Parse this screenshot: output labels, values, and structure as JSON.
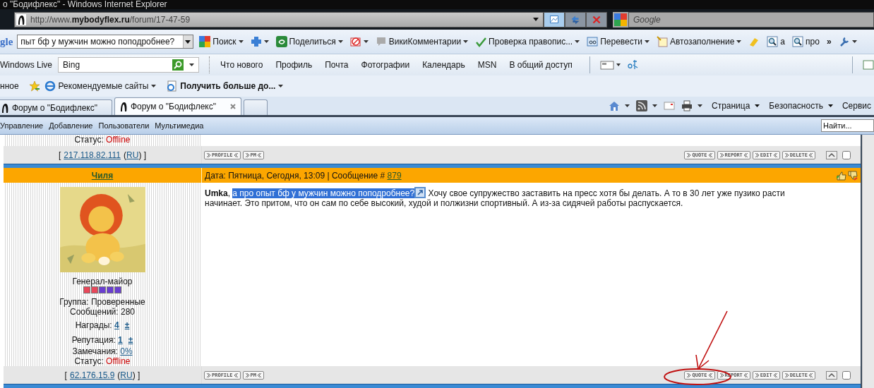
{
  "window": {
    "title": "о \"Бодифлекс\" - Windows Internet Explorer"
  },
  "address_bar": {
    "url": "http://www.**mybodyflex.ru**/forum/17-47-59"
  },
  "search_box": {
    "placeholder": "Google"
  },
  "google_toolbar": {
    "brand": "gle",
    "query": "пыт бф у мужчин можно поподробнее?",
    "items": [
      {
        "kind": "google",
        "label": "Поиск",
        "dropdown": true
      },
      {
        "kind": "plus",
        "dropdown": true
      },
      {
        "kind": "share",
        "label": "Поделиться",
        "dropdown": true
      },
      {
        "kind": "block",
        "dropdown": true
      },
      {
        "kind": "bubble",
        "label": "ВикиКомментарии",
        "dropdown": true
      },
      {
        "kind": "spell",
        "label": "Проверка правопис...",
        "dropdown": true
      },
      {
        "kind": "translate",
        "label": "Перевести",
        "dropdown": true
      },
      {
        "kind": "autofill",
        "label": "Автозаполнение",
        "dropdown": true
      },
      {
        "kind": "marker",
        "dropdown": false
      },
      {
        "kind": "find",
        "label": "а",
        "dropdown": false
      },
      {
        "kind": "find",
        "label": "про",
        "dropdown": false
      },
      {
        "kind": "more",
        "label": "»",
        "dropdown": false
      },
      {
        "kind": "wrench",
        "dropdown": true
      }
    ]
  },
  "live_bar": {
    "brand": "Windows Live",
    "search_value": "Bing",
    "links": [
      "Что нового",
      "Профиль",
      "Почта",
      "Фотографии",
      "Календарь",
      "MSN",
      "В общий доступ"
    ]
  },
  "favorites_bar": {
    "items": [
      {
        "kind": "text",
        "label": "нное"
      },
      {
        "kind": "star"
      },
      {
        "kind": "ie",
        "label": "Рекомендуемые сайты",
        "bold": false
      },
      {
        "kind": "page",
        "label": "Получить больше до...",
        "bold": true
      }
    ]
  },
  "tabs": [
    {
      "label": "Форум о \"Бодифлекс\"",
      "selected": false
    },
    {
      "label": "Форум о \"Бодифлекс\"",
      "selected": true
    }
  ],
  "command_bar": [
    "Страница",
    "Безопасность",
    "Сервис"
  ],
  "forum_menu": {
    "items": [
      "Управление",
      "Добавление",
      "Пользователи",
      "Мультимедиа"
    ],
    "search_placeholder": "Найти..."
  },
  "posts": [
    {
      "status_label": "Статус: ",
      "status": "Offline",
      "ip_open": "[",
      "ip": "217.118.82.111",
      "country_open": "(",
      "country": "RU",
      "ip_close": ") ]",
      "left_buttons": [
        "PROFILE",
        "PM"
      ],
      "right_buttons": [
        "QUOTE",
        "REPORT",
        "EDIT",
        "DELETE"
      ],
      "checked": false
    },
    {
      "author": "Чиля",
      "date": "Дата: Пятница, Сегодня, 13:09 | Сообщение # ",
      "number": "879",
      "rank": "Генерал-майор",
      "rank_pips": [
        {
          "color": "#e8485a"
        },
        {
          "color": "#e8485a"
        },
        {
          "color": "#6a3fd0"
        },
        {
          "color": "#6a3fd0"
        },
        {
          "color": "#6a3fd0"
        }
      ],
      "group": "Группа: Проверенные",
      "messages": "Сообщений: 280",
      "awards_label": "Награды: ",
      "awards": "4",
      "awards_action": "±",
      "reputation_label": "Репутация: ",
      "reputation": "1",
      "reputation_action": "±",
      "remarks_label": "Замечания: ",
      "remarks": "0%",
      "status_label": "Статус: ",
      "status": "Offline",
      "lead": "**Umka**, ",
      "selection": "а про опыт бф у мужчин можно поподробнее?",
      "body": "Хочу свое супружество заставить на пресс хотя бы делать. А то в 30 лет уже пузико расти начинает. Это притом, что он сам по себе высокий, худой и полжизни спортивный. А из-за сидячей работы распускается.",
      "ip_open": "[",
      "ip": "62.176.15.9",
      "country_open": "(",
      "country": "RU",
      "ip_close": ") ]",
      "left_buttons": [
        "PROFILE",
        "PM"
      ],
      "right_buttons": [
        "QUOTE",
        "REPORT",
        "EDIT",
        "DELETE"
      ],
      "checked": false
    }
  ]
}
